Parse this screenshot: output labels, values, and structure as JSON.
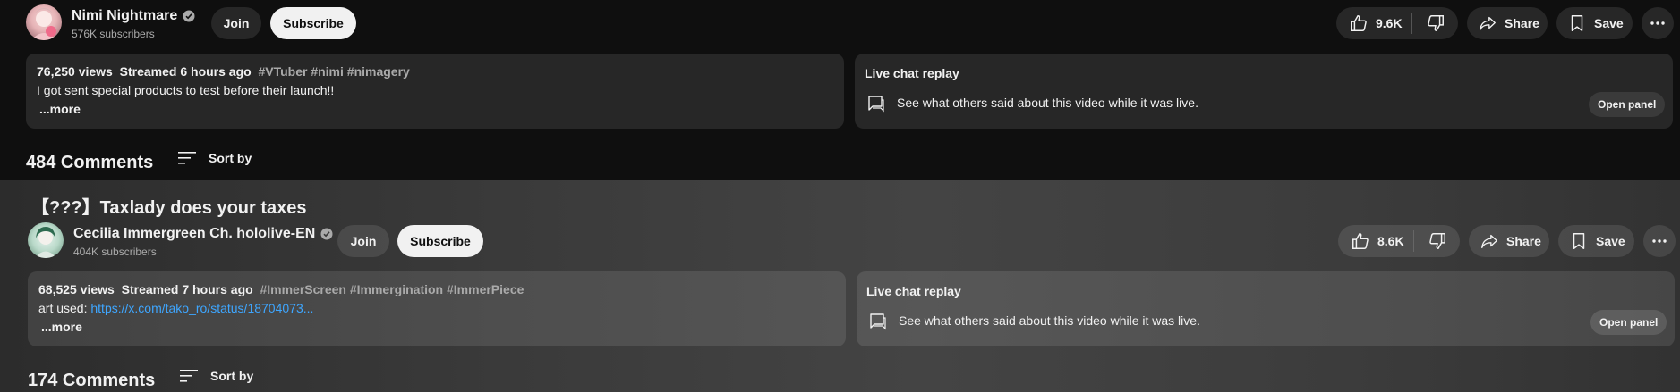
{
  "videos": [
    {
      "title": "",
      "channel": {
        "name": "Nimi Nightmare",
        "subscribers": "576K subscribers"
      },
      "join_label": "Join",
      "subscribe_label": "Subscribe",
      "likes": "9.6K",
      "share_label": "Share",
      "save_label": "Save",
      "description": {
        "views": "76,250 views",
        "streamed": "Streamed 6 hours ago",
        "tags": "#VTuber #nimi #nimagery",
        "text": "I got sent special products to test before their launch!!",
        "link": "",
        "more": "...more"
      },
      "live_chat": {
        "title": "Live chat replay",
        "text": "See what others said about this video while it was live.",
        "button": "Open panel"
      },
      "comments_count": "484 Comments",
      "sort_label": "Sort by"
    },
    {
      "title": "【???】Taxlady does your taxes",
      "channel": {
        "name": "Cecilia Immergreen Ch. hololive-EN",
        "subscribers": "404K subscribers"
      },
      "join_label": "Join",
      "subscribe_label": "Subscribe",
      "likes": "8.6K",
      "share_label": "Share",
      "save_label": "Save",
      "description": {
        "views": "68,525 views",
        "streamed": "Streamed 7 hours ago",
        "tags": "#ImmerScreen #Immergination #ImmerPiece",
        "text": "art used: ",
        "link": "https://x.com/tako_ro/status/18704073...",
        "more": "...more"
      },
      "live_chat": {
        "title": "Live chat replay",
        "text": "See what others said about this video while it was live.",
        "button": "Open panel"
      },
      "comments_count": "174 Comments",
      "sort_label": "Sort by"
    }
  ],
  "icons": {
    "verified": "verified-check-icon",
    "like": "thumbs-up-icon",
    "dislike": "thumbs-down-icon",
    "share": "share-arrow-icon",
    "save": "bookmark-icon",
    "more": "more-horizontal-icon",
    "chat": "chat-bubble-icon",
    "sort": "sort-lines-icon"
  },
  "colors": {
    "link": "#3ea6ff",
    "background": "#0f0f0f",
    "subscribe_bg": "#f1f1f1"
  }
}
